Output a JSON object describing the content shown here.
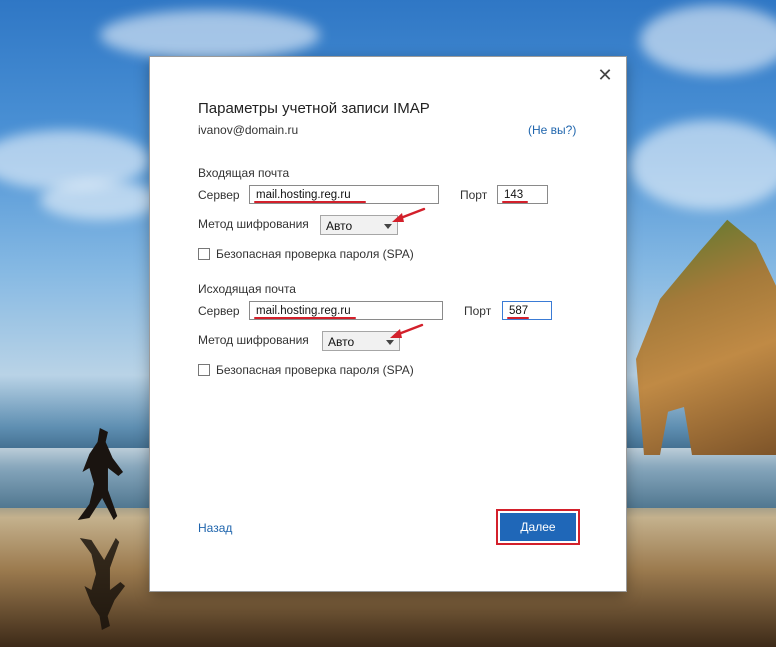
{
  "dialog": {
    "title": "Параметры учетной записи IMAP",
    "account": "ivanov@domain.ru",
    "not_you": "(Не вы?)",
    "close_glyph": "✕"
  },
  "incoming": {
    "section_label": "Входящая почта",
    "server_label": "Сервер",
    "server_value": "mail.hosting.reg.ru",
    "port_label": "Порт",
    "port_value": "143",
    "encryption_label": "Метод шифрования",
    "encryption_value": "Авто",
    "spa_label": "Безопасная проверка пароля (SPA)",
    "spa_checked": false
  },
  "outgoing": {
    "section_label": "Исходящая почта",
    "server_label": "Сервер",
    "server_value": "mail.hosting.reg.ru",
    "port_label": "Порт",
    "port_value": "587",
    "encryption_label": "Метод шифрования",
    "encryption_value": "Авто",
    "spa_label": "Безопасная проверка пароля (SPA)",
    "spa_checked": false
  },
  "footer": {
    "back_label": "Назад",
    "next_label": "Далее"
  },
  "colors": {
    "accent": "#1f67b8",
    "link": "#1f65ad",
    "annotation_red": "#d3202b"
  },
  "icons": {
    "close": "close-icon",
    "dropdown": "chevron-down-icon",
    "annotation": "arrow-annotation-icon"
  }
}
